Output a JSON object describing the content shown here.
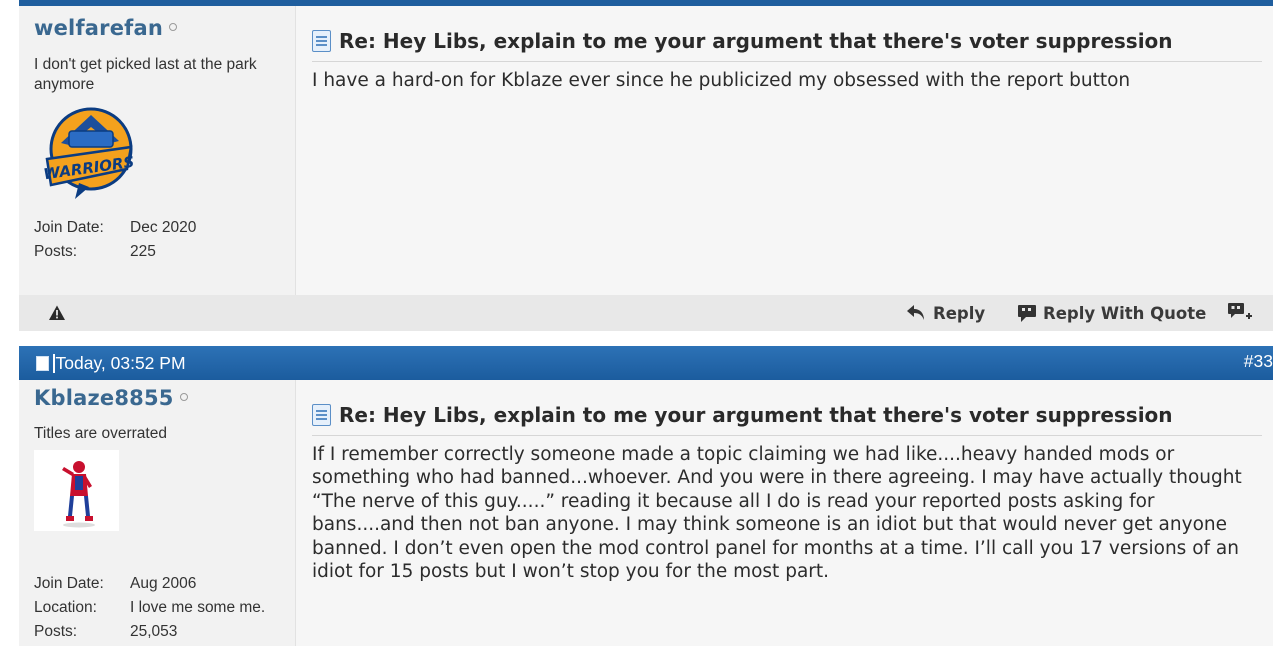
{
  "posts": [
    {
      "username": "welfarefan",
      "user_title": "I don't get picked last at the park anymore",
      "avatar_icon": "warriors-logo-icon",
      "stats": [
        {
          "label": "Join Date:",
          "value": "Dec 2020"
        },
        {
          "label": "Posts:",
          "value": "225"
        }
      ],
      "title": "Re: Hey Libs, explain to me your argument that there's voter suppression",
      "body": "I have a hard-on for Kblaze ever since he publicized my obsessed with the report button",
      "footer": {
        "reply_label": "Reply",
        "quote_label": "Reply With Quote"
      }
    },
    {
      "date": "Today, 03:52 PM",
      "post_number": "#33",
      "username": "Kblaze8855",
      "user_title": "Titles are overrated",
      "avatar_icon": "spider-man-avatar-icon",
      "stats": [
        {
          "label": "Join Date:",
          "value": "Aug 2006"
        },
        {
          "label": "Location:",
          "value": "I love me some me."
        },
        {
          "label": "Posts:",
          "value": "25,053"
        }
      ],
      "title": "Re: Hey Libs, explain to me your argument that there's voter suppression",
      "body": "If I remember correctly someone made a topic claiming we had like....heavy handed mods or something who had banned...whoever. And you were in there agreeing. I may have actually thought “The nerve of this guy.....” reading it because all I do is read your reported posts asking for bans....and then not ban anyone. I may think someone is an idiot but that would never get anyone banned. I don’t even open the mod control panel for months at a time. I’ll call you 17 versions of an idiot for 15 posts but I won’t stop you for the most part."
    }
  ],
  "colors": {
    "header_blue": "#1f5e9e",
    "username_blue": "#3a6890",
    "footer_gray": "#e8e8e8"
  }
}
